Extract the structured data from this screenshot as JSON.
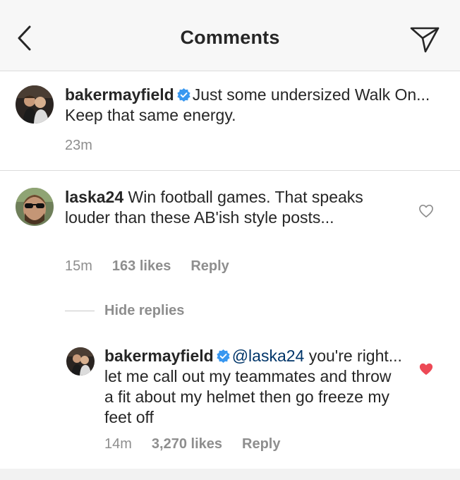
{
  "header": {
    "title": "Comments",
    "back_icon": "chevron-left-icon",
    "share_icon": "direct-send-icon"
  },
  "caption": {
    "username": "bakermayfield",
    "verified": true,
    "text": "Just some undersized Walk On... Keep that same energy.",
    "time": "23m"
  },
  "comments": [
    {
      "username": "laska24",
      "verified": false,
      "text": "Win football games. That speaks louder than these AB'ish style posts...",
      "time": "15m",
      "likes": "163 likes",
      "reply_label": "Reply",
      "liked": false
    }
  ],
  "hide_replies_label": "Hide replies",
  "replies": [
    {
      "username": "bakermayfield",
      "verified": true,
      "mention": "@laska24",
      "text": "you're right... let me call out my teammates and throw a fit about my helmet then go freeze my feet off",
      "time": "14m",
      "likes": "3,270 likes",
      "reply_label": "Reply",
      "liked": true
    }
  ],
  "colors": {
    "verified_blue": "#3897f0",
    "liked_red": "#ed4956",
    "mention": "#003569",
    "meta_gray": "#8e8e8e"
  }
}
